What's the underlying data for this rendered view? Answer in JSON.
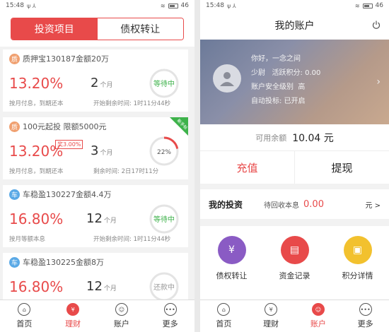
{
  "status": {
    "time": "15:48",
    "battery": "46"
  },
  "invest_screen": {
    "segments": [
      "投资项目",
      "债权转让"
    ],
    "cards": [
      {
        "title": "质押宝130187金额20万",
        "icon_text": "质",
        "icon_color": "#f0a070",
        "rate": "13.20%",
        "term_num": "2",
        "term_unit": "个月",
        "foot_left": "按月付息，到期还本",
        "foot_right": "开始剩余时间: 1时11分44秒",
        "status": "等待中",
        "progress": null,
        "new_badge": false,
        "tag": null,
        "rate_color": "#e84a4a"
      },
      {
        "title": "100元起投 限额5000元",
        "icon_text": "质",
        "icon_color": "#f0a070",
        "rate": "13.20%",
        "term_num": "3",
        "term_unit": "个月",
        "foot_left": "按月付息，到期还本",
        "foot_right": "剩余时间: 2日17时11分",
        "status": "22%",
        "progress": 0.22,
        "new_badge": true,
        "badge_text": "新手标",
        "tag": "奖3.00%",
        "rate_color": "#e84a4a"
      },
      {
        "title": "车稳盈130227金额4.4万",
        "icon_text": "车",
        "icon_color": "#5aa9e6",
        "rate": "16.80%",
        "term_num": "12",
        "term_unit": "个月",
        "foot_left": "按月等额本息",
        "foot_right": "开始剩余时间: 1时11分44秒",
        "status": "等待中",
        "progress": null,
        "new_badge": false,
        "tag": null,
        "rate_color": "#e84a4a"
      },
      {
        "title": "车稳盈130225金额8万",
        "icon_text": "车",
        "icon_color": "#5aa9e6",
        "rate": "16.80%",
        "term_num": "12",
        "term_unit": "个月",
        "foot_left": "",
        "foot_right": "",
        "status": "还款中",
        "progress": null,
        "new_badge": false,
        "tag": null,
        "rate_color": "#e84a4a"
      }
    ],
    "tabs": [
      {
        "label": "首页",
        "glyph": "⌂",
        "active": false
      },
      {
        "label": "理财",
        "glyph": "¥",
        "active": true
      },
      {
        "label": "账户",
        "glyph": "☺",
        "active": false
      },
      {
        "label": "更多",
        "glyph": "•••",
        "active": false
      }
    ]
  },
  "account_screen": {
    "title": "我的账户",
    "greeting": "你好，一念之间",
    "rank_label": "少尉",
    "points_label": "活跃积分: 0.00",
    "security_label": "账户安全级别",
    "security_value": "高",
    "auto_bid": "自动投标: 已开启",
    "balance_label": "可用余额",
    "balance_value": "10.04 元",
    "recharge": "充值",
    "withdraw": "提现",
    "my_invest": "我的投资",
    "pending_label": "待回收本息",
    "pending_value": "0.00",
    "unit": "元 >",
    "grid": [
      {
        "label": "债权转让",
        "color": "#8a5bc4",
        "glyph": "¥"
      },
      {
        "label": "资金记录",
        "color": "#e84a4a",
        "glyph": "▤"
      },
      {
        "label": "积分详情",
        "color": "#f2c12e",
        "glyph": "▣"
      }
    ],
    "tabs": [
      {
        "label": "首页",
        "glyph": "⌂",
        "active": false
      },
      {
        "label": "理财",
        "glyph": "¥",
        "active": false
      },
      {
        "label": "账户",
        "glyph": "☺",
        "active": true
      },
      {
        "label": "更多",
        "glyph": "•••",
        "active": false
      }
    ]
  }
}
